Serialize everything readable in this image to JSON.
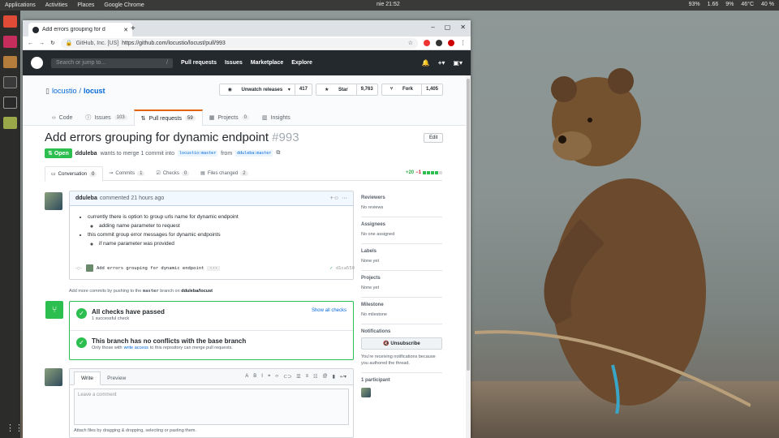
{
  "desktop": {
    "menu": [
      "Applications",
      "Activities",
      "Places",
      "Google Chrome"
    ],
    "clock": "nie 21:52",
    "tray": [
      "93%",
      "1.66",
      "9%",
      "46°C",
      "40 %"
    ]
  },
  "browser": {
    "tab_title": "Add errors grouping for d",
    "org": "GitHub, Inc. [US]",
    "url": "https://github.com/locustio/locust/pull/993"
  },
  "github": {
    "search_placeholder": "Search or jump to...",
    "nav": [
      "Pull requests",
      "Issues",
      "Marketplace",
      "Explore"
    ]
  },
  "repo": {
    "owner": "locustio",
    "sep": "/",
    "name": "locust",
    "watch_label": "Unwatch releases",
    "watch_count": "417",
    "star_label": "Star",
    "star_count": "9,763",
    "fork_label": "Fork",
    "fork_count": "1,405",
    "tabs": [
      {
        "label": "Code",
        "count": ""
      },
      {
        "label": "Issues",
        "count": "103"
      },
      {
        "label": "Pull requests",
        "count": "59"
      },
      {
        "label": "Projects",
        "count": "0"
      },
      {
        "label": "Insights",
        "count": ""
      }
    ]
  },
  "pr": {
    "title": "Add errors grouping for dynamic endpoint",
    "number": "#993",
    "edit_label": "Edit",
    "state": "Open",
    "author": "ddulebа",
    "merge_text": "wants to merge 1 commit into",
    "base": "locustio:master",
    "from": "from",
    "head": "ddulebа:master",
    "tabs": [
      {
        "label": "Conversation",
        "count": "0"
      },
      {
        "label": "Commits",
        "count": "1"
      },
      {
        "label": "Checks",
        "count": "0"
      },
      {
        "label": "Files changed",
        "count": "2"
      }
    ],
    "additions": "+20",
    "deletions": "−1"
  },
  "comment": {
    "author": "dduleba",
    "meta": "commented 21 hours ago",
    "items": [
      "currently there is option to group urls name for dynamic endpoint",
      "adding name parameter to request",
      "this commit group error messages for dynamic endpoints",
      "if name parameter was provided"
    ]
  },
  "commit": {
    "message": "Add errors grouping for dynamic endpoint",
    "sha": "d1ca550"
  },
  "addmore": {
    "prefix": "Add more commits by pushing to the",
    "branch": "master",
    "mid": "branch on",
    "repo": "dduleba/locust"
  },
  "merge": {
    "checks_title": "All checks have passed",
    "checks_sub": "1 successful check",
    "show_all": "Show all checks",
    "conflict_title": "This branch has no conflicts with the base branch",
    "conflict_pre": "Only those with",
    "conflict_link": "write access",
    "conflict_post": "to this repository can merge pull requests."
  },
  "editor": {
    "write": "Write",
    "preview": "Preview",
    "placeholder": "Leave a comment",
    "attach": "Attach files by dragging & dropping, selecting or pasting them."
  },
  "sidebar": {
    "reviewers": {
      "title": "Reviewers",
      "value": "No reviews"
    },
    "assignees": {
      "title": "Assignees",
      "value": "No one assigned"
    },
    "labels": {
      "title": "Labels",
      "value": "None yet"
    },
    "projects": {
      "title": "Projects",
      "value": "None yet"
    },
    "milestone": {
      "title": "Milestone",
      "value": "No milestone"
    },
    "notifications": {
      "title": "Notifications",
      "button": "Unsubscribe",
      "text": "You're receiving notifications because you authored the thread."
    },
    "participants": {
      "title": "1 participant"
    }
  }
}
